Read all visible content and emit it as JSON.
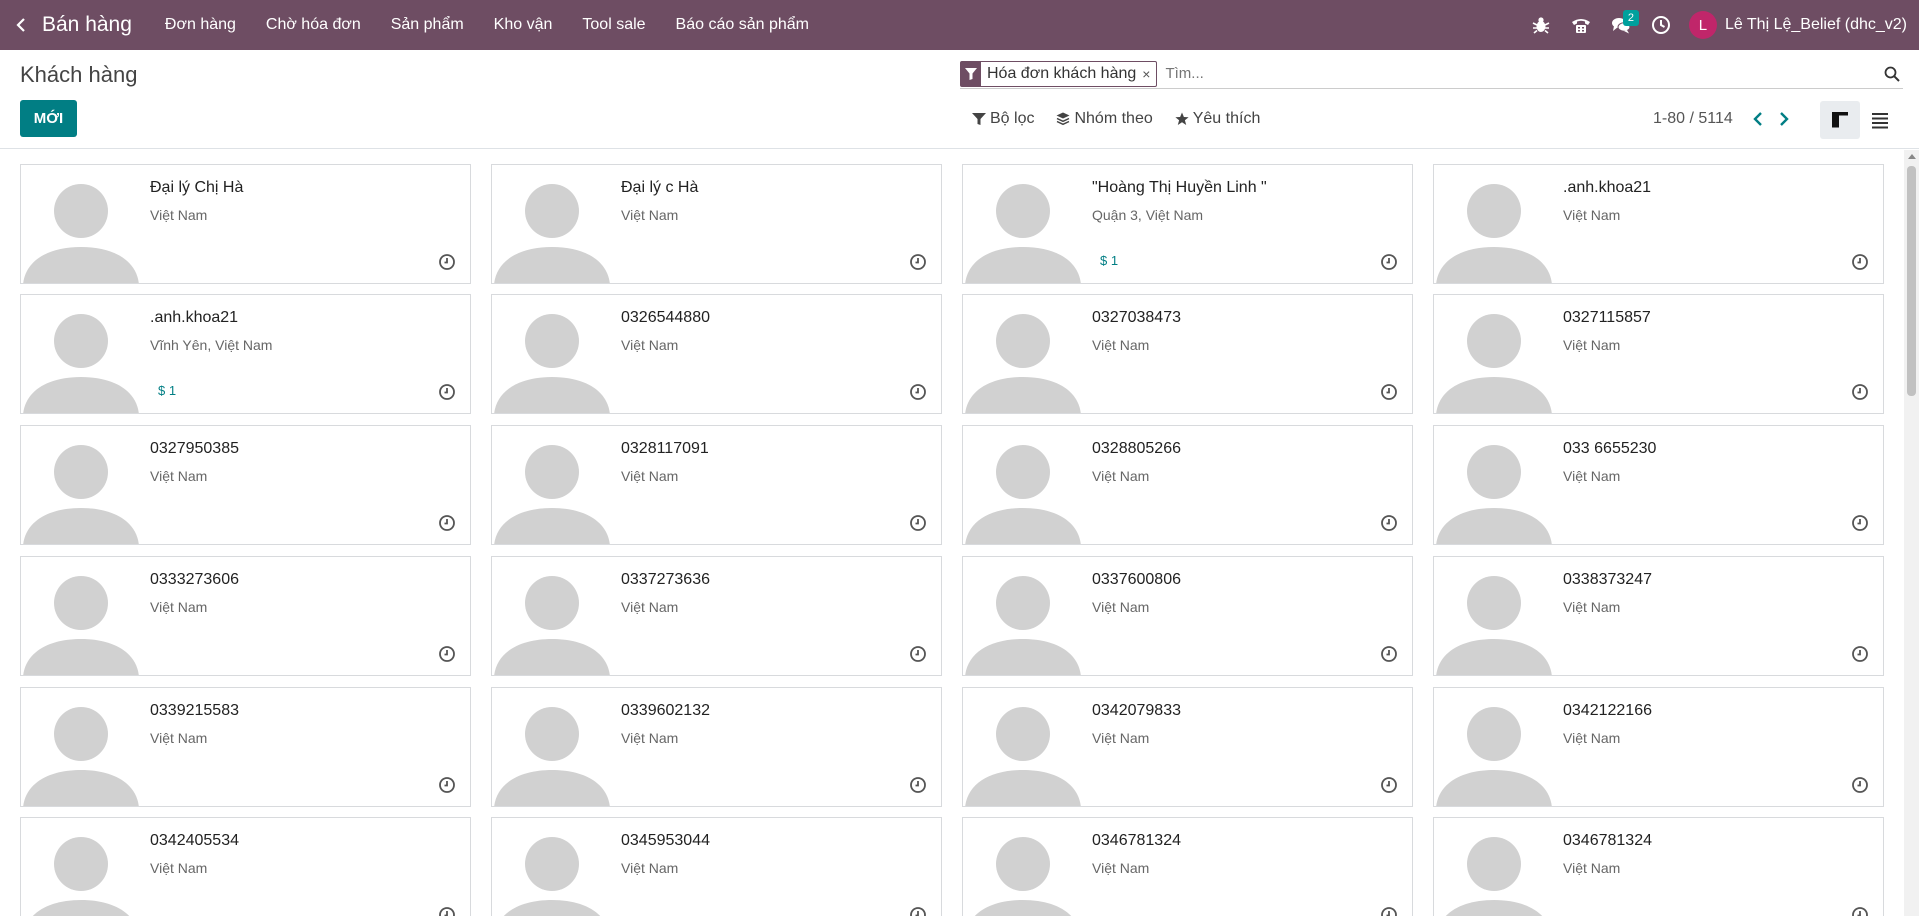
{
  "navbar": {
    "app_name": "Bán hàng",
    "menu": [
      "Đơn hàng",
      "Chờ hóa đơn",
      "Sản phẩm",
      "Kho vận",
      "Tool sale",
      "Báo cáo sản phẩm"
    ],
    "messages_badge": "2",
    "user_initial": "L",
    "user_name": "Lê Thị Lệ_Belief (dhc_v2)"
  },
  "control": {
    "title": "Khách hàng",
    "new_button": "MỚI",
    "facet_label": "Hóa đơn khách hàng",
    "facet_close": "×",
    "search_placeholder": "Tìm...",
    "filter_label": "Bộ lọc",
    "group_label": "Nhóm theo",
    "favorite_label": "Yêu thích",
    "pager": "1-80 / 5114"
  },
  "colors": {
    "navbar": "#6e4d63",
    "primary": "#017e84",
    "badge": "#00a09d",
    "avatar": "#c0266a"
  },
  "customers": [
    {
      "name": "Đại lý Chị Hà",
      "address": "Việt Nam",
      "amount": ""
    },
    {
      "name": "Đại lý c Hà",
      "address": "Việt Nam",
      "amount": ""
    },
    {
      "name": "\"Hoàng Thị Huyền Linh \"",
      "address": "Quận 3, Việt Nam",
      "amount": "$ 1"
    },
    {
      "name": ".anh.khoa21",
      "address": "Việt Nam",
      "amount": ""
    },
    {
      "name": ".anh.khoa21",
      "address": "Vĩnh Yên, Việt Nam",
      "amount": "$ 1"
    },
    {
      "name": "0326544880",
      "address": "Việt Nam",
      "amount": ""
    },
    {
      "name": "0327038473",
      "address": "Việt Nam",
      "amount": ""
    },
    {
      "name": "0327115857",
      "address": "Việt Nam",
      "amount": ""
    },
    {
      "name": "0327950385",
      "address": "Việt Nam",
      "amount": ""
    },
    {
      "name": "0328117091",
      "address": "Việt Nam",
      "amount": ""
    },
    {
      "name": "0328805266",
      "address": "Việt Nam",
      "amount": ""
    },
    {
      "name": "033 6655230",
      "address": "Việt Nam",
      "amount": ""
    },
    {
      "name": "0333273606",
      "address": "Việt Nam",
      "amount": ""
    },
    {
      "name": "0337273636",
      "address": "Việt Nam",
      "amount": ""
    },
    {
      "name": "0337600806",
      "address": "Việt Nam",
      "amount": ""
    },
    {
      "name": "0338373247",
      "address": "Việt Nam",
      "amount": ""
    },
    {
      "name": "0339215583",
      "address": "Việt Nam",
      "amount": ""
    },
    {
      "name": "0339602132",
      "address": "Việt Nam",
      "amount": ""
    },
    {
      "name": "0342079833",
      "address": "Việt Nam",
      "amount": ""
    },
    {
      "name": "0342122166",
      "address": "Việt Nam",
      "amount": ""
    },
    {
      "name": "0342405534",
      "address": "Việt Nam",
      "amount": ""
    },
    {
      "name": "0345953044",
      "address": "Việt Nam",
      "amount": ""
    },
    {
      "name": "0346781324",
      "address": "Việt Nam",
      "amount": ""
    },
    {
      "name": "0346781324",
      "address": "Việt Nam",
      "amount": ""
    }
  ]
}
